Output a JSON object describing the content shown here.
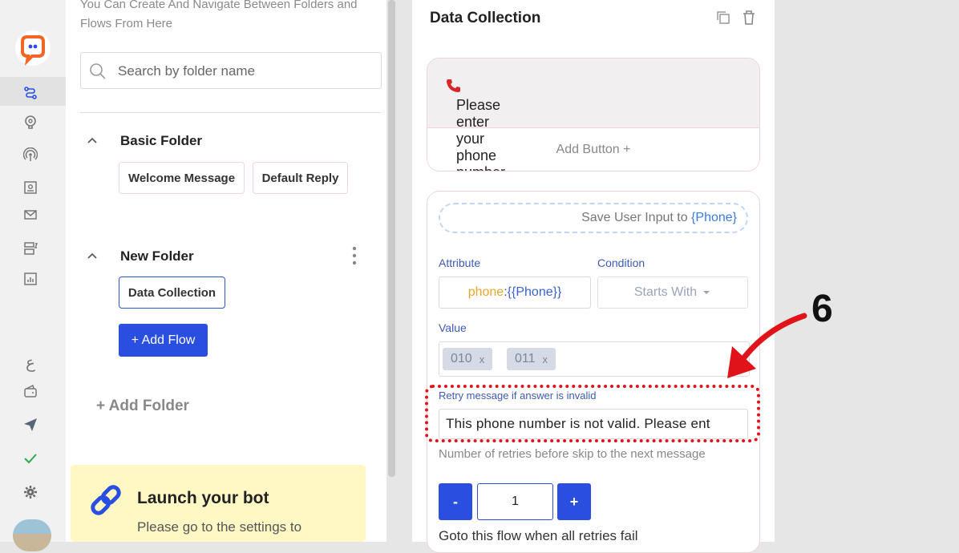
{
  "sidebar": {
    "icons": [
      "logo-icon",
      "flows-icon",
      "brain-icon",
      "broadcast-icon",
      "contacts-icon",
      "mail-icon",
      "forms-icon",
      "analytics-icon",
      "language-icon",
      "wallet-icon",
      "send-icon",
      "check-icon",
      "gear-icon"
    ]
  },
  "folders_panel": {
    "intro": "You Can Create And Navigate Between Folders and Flows From Here",
    "search_placeholder": "Search by folder name",
    "folders": [
      {
        "title": "Basic Folder",
        "flows": [
          "Welcome Message",
          "Default Reply"
        ]
      },
      {
        "title": "New Folder",
        "flows": [
          "Data Collection"
        ]
      }
    ],
    "add_flow": "+ Add Flow",
    "add_folder": "+ Add Folder",
    "launch_title": "Launch your bot",
    "launch_text": "Please go to the settings to"
  },
  "editor": {
    "title": "Data Collection",
    "message": "Please enter your phone number",
    "add_button": "Add Button +",
    "save_input_prefix": "Save User Input to ",
    "save_input_var": "{Phone}",
    "attribute_label": "Attribute",
    "attribute_key": "phone",
    "attribute_sep": ":",
    "attribute_val": "{{Phone}}",
    "condition_label": "Condition",
    "condition_value": "Starts With",
    "value_label": "Value",
    "value_tags": [
      "010",
      "011"
    ],
    "retry_label": "Retry message if answer is invalid",
    "retry_value": "This phone number is not valid. Please ent",
    "retries_label": "Number of retries before skip to the next message",
    "minus": "-",
    "retries_value": "1",
    "plus": "+",
    "goto_label": "Goto this flow when all retries fail"
  },
  "annotation": {
    "number": "6"
  },
  "colors": {
    "accent": "#2a4fe0",
    "annotation": "#e0131b",
    "brand": "#f26522"
  }
}
